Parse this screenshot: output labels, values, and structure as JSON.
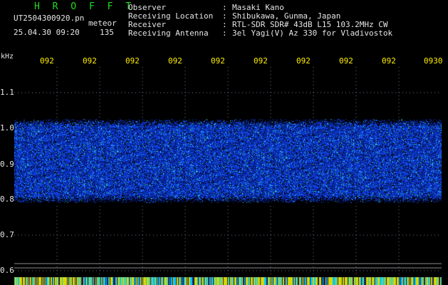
{
  "header": {
    "title": "H R O F F T",
    "file_name": "UT2504300920.pn",
    "meteor_label": "meteor",
    "date_time": "25.04.30 09:20",
    "meteor_count": "135"
  },
  "info": [
    {
      "key": "Observer",
      "value": "Masaki Kano"
    },
    {
      "key": "Receiving Location",
      "value": "Shibukawa, Gunma, Japan"
    },
    {
      "key": "Receiver",
      "value": "RTL-SDR SDR# 43dB L15 103.2MHz CW"
    },
    {
      "key": "Receiving Antenna",
      "value": "3el Yagi(V) Az 330 for Vladivostok"
    }
  ],
  "info_separator": ":",
  "axis": {
    "unit": "kHz",
    "y_ticks": [
      "1.1",
      "1.0",
      "0.9",
      "0.8",
      "0.7",
      "0.6"
    ],
    "x_ticks": [
      "092",
      "092",
      "092",
      "092",
      "092",
      "092",
      "092",
      "092",
      "092",
      "0930"
    ]
  },
  "colors": {
    "background": "#000000",
    "title_green": "#22dd22",
    "time_tick_yellow": "#ffee00",
    "noise_blue": "#1030ff",
    "noise_cyan": "#30d0ff",
    "noise_green": "#50ff80",
    "grid_dots": "#6a6a8a",
    "bottom_strip_yellow": "#d8d800",
    "bottom_strip_cyan": "#00c8ff"
  }
}
